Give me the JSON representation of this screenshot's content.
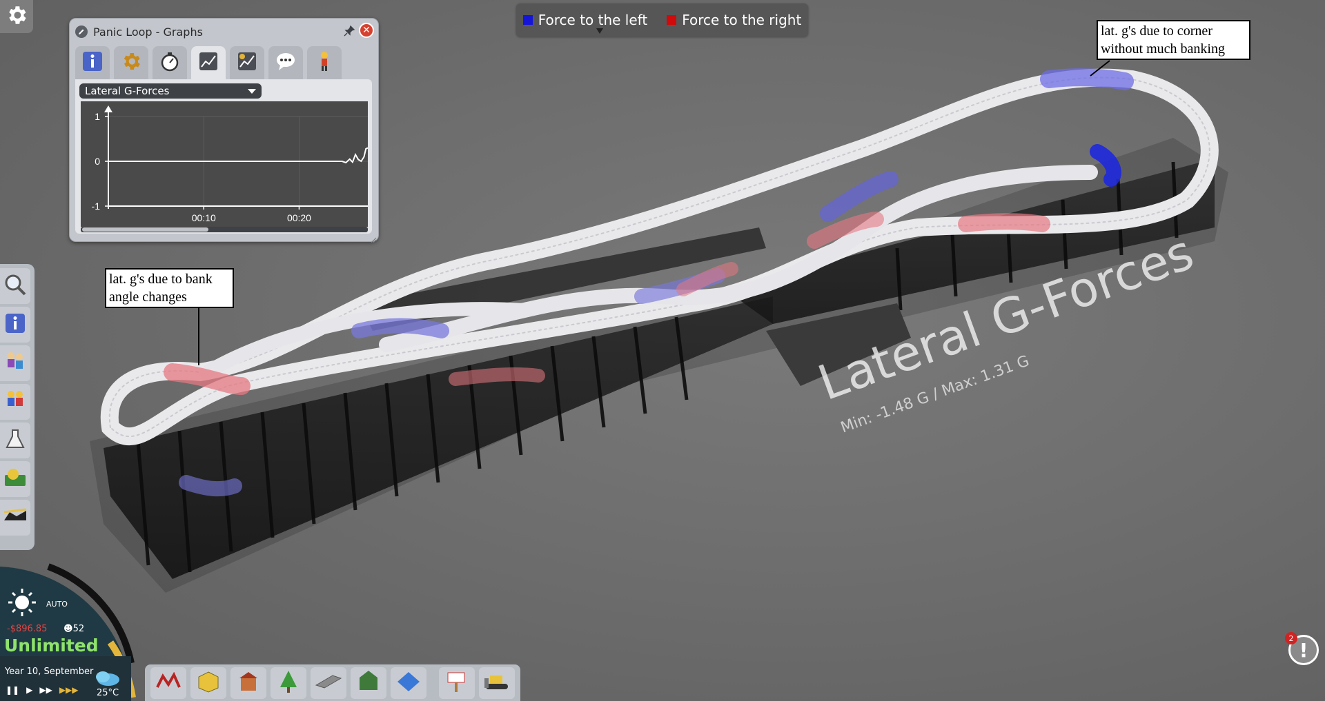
{
  "legend": {
    "left_label": "Force to the left",
    "right_label": "Force to the right",
    "left_color": "#1515d8",
    "right_color": "#d00a0a"
  },
  "callouts": {
    "corner": "lat. g's due to corner\nwithout much banking",
    "bank": "lat. g's due to bank\nangle changes"
  },
  "overlay": {
    "title": "Lateral G-Forces",
    "subtitle": "Min: -1.48 G / Max: 1.31 G"
  },
  "graph_window": {
    "title": "Panic Loop - Graphs",
    "selected_graph": "Lateral G-Forces",
    "tabs": [
      "info-icon",
      "settings-cog-icon",
      "stopwatch-icon",
      "graph-icon",
      "finance-graph-icon",
      "speech-bubble-icon",
      "mechanic-icon"
    ],
    "active_tab": 3
  },
  "chart_data": {
    "type": "line",
    "title": "",
    "xlabel": "",
    "ylabel": "",
    "x_ticks": [
      "00:10",
      "00:20"
    ],
    "y_ticks": [
      "1",
      "0",
      "-1"
    ],
    "ylim": [
      -1,
      1
    ],
    "xlim": [
      0,
      27.2
    ],
    "grid": true,
    "series": [
      {
        "x": [
          0,
          24.5,
          24.9,
          25.3,
          25.6,
          25.9,
          26.2,
          26.5,
          26.8,
          27.0,
          27.2
        ],
        "values": [
          0,
          0,
          -0.03,
          0.05,
          -0.02,
          0.15,
          0.04,
          0.0,
          0.1,
          0.28,
          0.3
        ]
      }
    ]
  },
  "hud": {
    "weather_mode": "AUTO",
    "money": "-$896.85",
    "guests": "52",
    "budget_label": "Unlimited",
    "date": "Year 10, September",
    "temperature": "25°C"
  },
  "notifications": {
    "count": "2"
  },
  "left_toolbar": [
    "search-icon",
    "info-icon",
    "guests-icon",
    "staff-icon",
    "research-icon",
    "finances-icon",
    "rides-icon"
  ],
  "build_toolbar": [
    "coaster-build-icon",
    "shops-icon",
    "buildings-icon",
    "scenery-tree-icon",
    "paths-icon",
    "terrain-icon",
    "blueprint-icon",
    "paint-icon",
    "bulldozer-icon"
  ]
}
